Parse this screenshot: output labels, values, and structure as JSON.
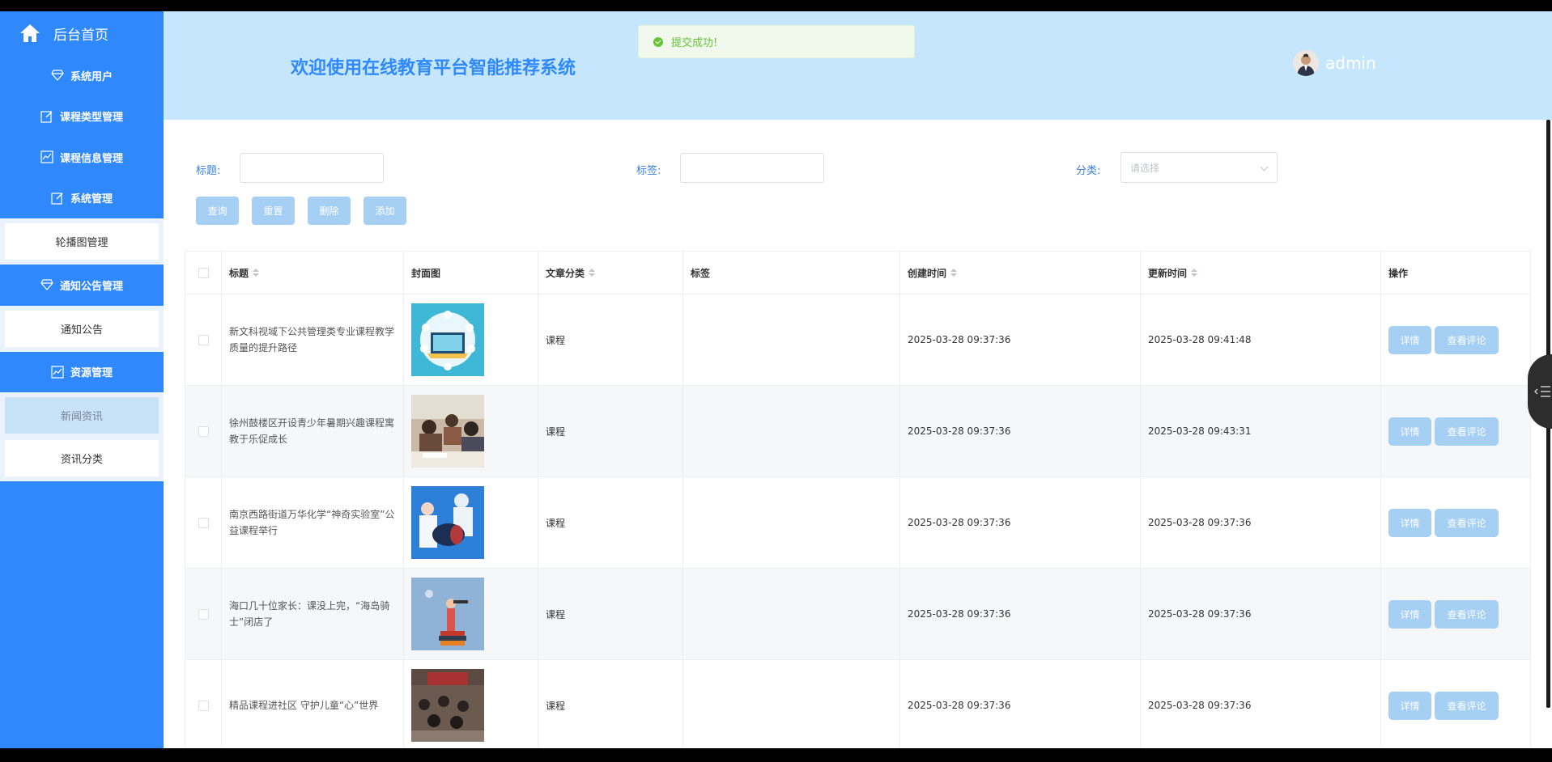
{
  "sidebar": {
    "home_label": "后台首页",
    "menu": [
      {
        "label": "系统用户",
        "icon": "diamond-icon"
      },
      {
        "label": "课程类型管理",
        "icon": "edit-icon"
      },
      {
        "label": "课程信息管理",
        "icon": "chart-icon"
      },
      {
        "label": "系统管理",
        "icon": "edit-icon"
      }
    ],
    "system_sub": [
      "轮播图管理"
    ],
    "notice_label": "通知公告管理",
    "notice_sub": [
      "通知公告"
    ],
    "resource_label": "资源管理",
    "resource_sub": [
      "新闻资讯",
      "资讯分类"
    ]
  },
  "header": {
    "title": "欢迎使用在线教育平台智能推荐系统",
    "toast": "提交成功!",
    "user": "admin"
  },
  "filters": {
    "title_label": "标题:",
    "tag_label": "标签:",
    "category_label": "分类:",
    "category_placeholder": "请选择"
  },
  "buttons": {
    "query": "查询",
    "reset": "重置",
    "delete": "删除",
    "add": "添加"
  },
  "table": {
    "columns": [
      "标题",
      "封面图",
      "文章分类",
      "标签",
      "创建时间",
      "更新时间",
      "操作"
    ],
    "rows": [
      {
        "title": "新文科视域下公共管理类专业课程教学质量的提升路径",
        "category": "课程",
        "tag": "",
        "created": "2025-03-28 09:37:36",
        "updated": "2025-03-28 09:41:48"
      },
      {
        "title": "徐州鼓楼区开设青少年暑期兴趣课程寓教于乐促成长",
        "category": "课程",
        "tag": "",
        "created": "2025-03-28 09:37:36",
        "updated": "2025-03-28 09:43:31"
      },
      {
        "title": "南京西路街道万华化学“神奇实验室”公益课程举行",
        "category": "课程",
        "tag": "",
        "created": "2025-03-28 09:37:36",
        "updated": "2025-03-28 09:37:36"
      },
      {
        "title": "海口几十位家长：课没上完，“海岛骑士”闭店了",
        "category": "课程",
        "tag": "",
        "created": "2025-03-28 09:37:36",
        "updated": "2025-03-28 09:37:36"
      },
      {
        "title": "精品课程进社区 守护儿童“心”世界",
        "category": "课程",
        "tag": "",
        "created": "2025-03-28 09:37:36",
        "updated": "2025-03-28 09:37:36"
      }
    ],
    "detail_label": "详情",
    "comments_label": "查看评论"
  }
}
